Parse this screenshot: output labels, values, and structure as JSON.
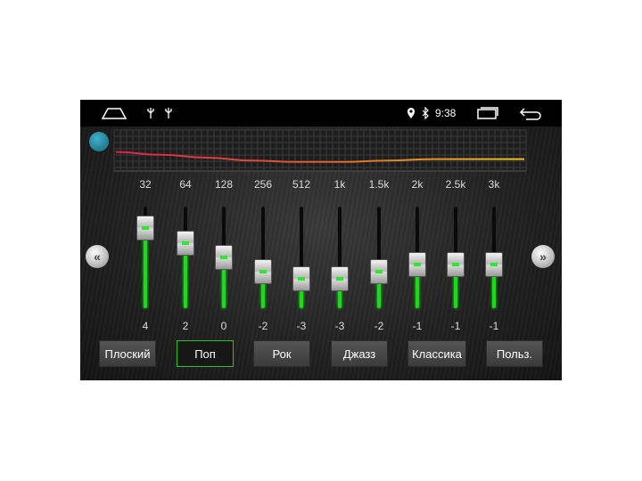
{
  "status_bar": {
    "time": "9:38",
    "icons": [
      "home-icon",
      "usb-icon",
      "usb-icon",
      "location-pin-icon",
      "bluetooth-icon",
      "recent-apps-icon",
      "back-icon"
    ]
  },
  "equalizer": {
    "bands": [
      {
        "freq": "32",
        "value": 4
      },
      {
        "freq": "64",
        "value": 2
      },
      {
        "freq": "128",
        "value": 0
      },
      {
        "freq": "256",
        "value": -2
      },
      {
        "freq": "512",
        "value": -3
      },
      {
        "freq": "1k",
        "value": -3
      },
      {
        "freq": "1.5k",
        "value": -2
      },
      {
        "freq": "2k",
        "value": -1
      },
      {
        "freq": "2.5k",
        "value": -1
      },
      {
        "freq": "3k",
        "value": -1
      }
    ],
    "value_range": [
      -7,
      7
    ]
  },
  "presets": [
    {
      "label": "Плоский",
      "active": false
    },
    {
      "label": "Поп",
      "active": true
    },
    {
      "label": "Рок",
      "active": false
    },
    {
      "label": "Джазз",
      "active": false
    },
    {
      "label": "Классика",
      "active": false
    },
    {
      "label": "Польз.",
      "active": false
    }
  ],
  "nav": {
    "prev": "«",
    "next": "»"
  },
  "colors": {
    "accent": "#1ed81e",
    "curve_start": "#e0204a",
    "curve_end": "#f0c020"
  }
}
